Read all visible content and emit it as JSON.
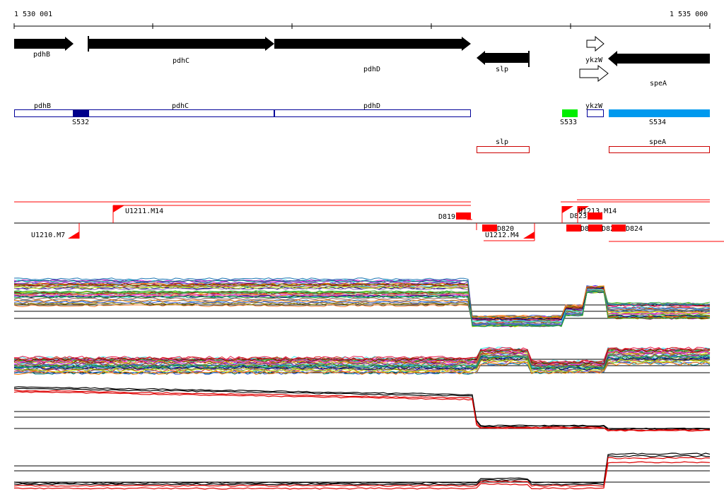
{
  "ruler": {
    "start_label": "1 530 001",
    "end_label": "1 535 000"
  },
  "genes": [
    {
      "name": "pdhB",
      "strand": "+",
      "filled": true
    },
    {
      "name": "pdhC",
      "strand": "+",
      "filled": true
    },
    {
      "name": "pdhD",
      "strand": "+",
      "filled": true
    },
    {
      "name": "slp",
      "strand": "-",
      "filled": true
    },
    {
      "name": "ykzW",
      "strand": "+",
      "filled": false
    },
    {
      "name": "ykzW",
      "strand": "+",
      "filled": false
    },
    {
      "name": "speA",
      "strand": "-",
      "filled": true
    }
  ],
  "gene_label_ykzW": "ykzW",
  "plus_track": {
    "labels": [
      "pdhB",
      "pdhC",
      "pdhD",
      "ykzW"
    ],
    "segments": [
      {
        "name": "S532",
        "color": "#00008b"
      },
      {
        "name": "S533",
        "color": "#00ee00"
      },
      {
        "name": "S534",
        "color": "#0099ee"
      }
    ]
  },
  "minus_track": {
    "labels": [
      "slp",
      "speA"
    ]
  },
  "transcripts": {
    "upstream": [
      "U1210.M7",
      "U1211.M14",
      "U1212.M4",
      "U1213.M14"
    ],
    "downstream": [
      "D819",
      "D820",
      "D821",
      "D822",
      "D823",
      "D824"
    ]
  },
  "colors": {
    "gene": "#000000",
    "plus_box": "#000099",
    "minus_box": "#cc0000",
    "transcript": "#ff0000",
    "profile_highlight": "#dd0000"
  }
}
